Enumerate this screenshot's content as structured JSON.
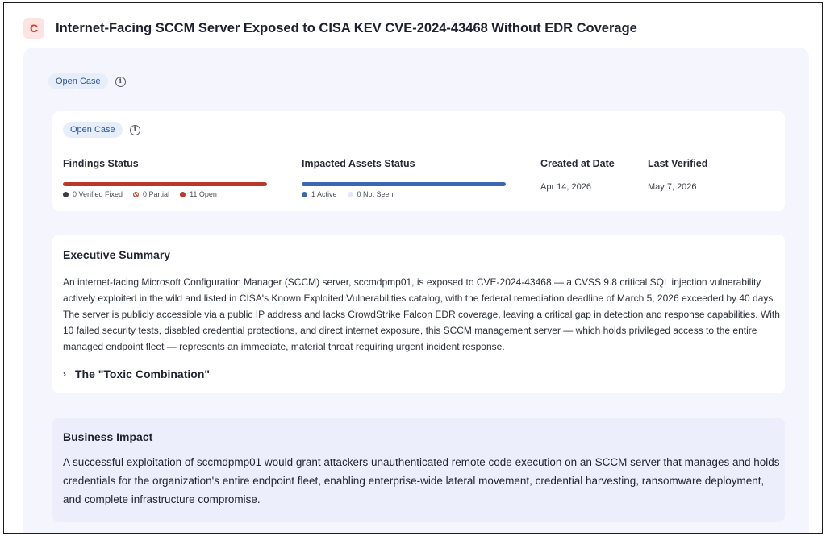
{
  "header": {
    "logo_letter": "C",
    "title": "Internet-Facing SCCM Server Exposed to CISA KEV CVE-2024-43468 Without EDR Coverage"
  },
  "case_status": {
    "label": "Open Case",
    "info_icon": "info-icon"
  },
  "status_card": {
    "case_status_label": "Open Case",
    "findings": {
      "label": "Findings Status",
      "legend": [
        {
          "label": "0 Verified Fixed",
          "color": "#3a3d45"
        },
        {
          "label": "0 Partial",
          "color": "#c04a3a"
        },
        {
          "label": "11 Open",
          "color": "#b8392a"
        }
      ]
    },
    "assets": {
      "label": "Impacted Assets Status",
      "legend": [
        {
          "label": "1 Active",
          "color": "#3e67b1"
        },
        {
          "label": "0 Not Seen",
          "color": "#e3e7f3"
        }
      ]
    },
    "created": {
      "label": "Created at Date",
      "value": "Apr 14, 2026"
    },
    "verified": {
      "label": "Last Verified",
      "value": "May 7, 2026"
    }
  },
  "executive_summary": {
    "title": "Executive Summary",
    "text": "An internet-facing Microsoft Configuration Manager (SCCM) server, sccmdpmp01, is exposed to CVE-2024-43468 — a CVSS 9.8 critical SQL injection vulnerability actively exploited in the wild and listed in CISA's Known Exploited Vulnerabilities catalog, with the federal remediation deadline of March 5, 2026 exceeded by 40 days. The server is publicly accessible via a public IP address and lacks CrowdStrike Falcon EDR coverage, leaving a critical gap in detection and response capabilities. With 10 failed security tests, disabled credential protections, and direct internet exposure, this SCCM management server — which holds privileged access to the entire managed endpoint fleet — represents an immediate, material threat requiring urgent incident response.",
    "toxic_label": "The \"Toxic Combination\""
  },
  "business_impact": {
    "title": "Business Impact",
    "text": "A successful exploitation of sccmdpmp01 would grant attackers unauthenticated remote code execution on an SCCM server that manages and holds credentials for the organization's entire endpoint fleet, enabling enterprise-wide lateral movement, credential harvesting, ransomware deployment, and complete infrastructure compromise."
  }
}
